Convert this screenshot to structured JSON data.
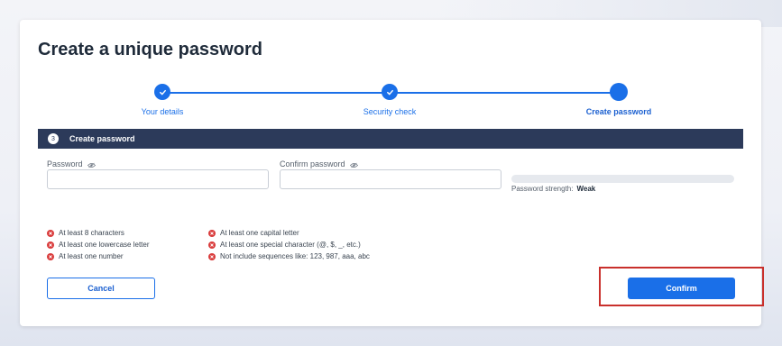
{
  "page": {
    "title": "Create a unique password"
  },
  "stepper": {
    "steps": [
      {
        "label": "Your details",
        "state": "done"
      },
      {
        "label": "Security check",
        "state": "done"
      },
      {
        "label": "Create password",
        "state": "current"
      }
    ]
  },
  "section": {
    "number": "3",
    "title": "Create password"
  },
  "fields": {
    "password": {
      "label": "Password",
      "value": "",
      "placeholder": ""
    },
    "confirm": {
      "label": "Confirm password",
      "value": "",
      "placeholder": ""
    }
  },
  "strength": {
    "label": "Password strength:",
    "value": "Weak",
    "level": 0
  },
  "rules": {
    "col1": [
      "At least 8 characters",
      "At least one lowercase letter",
      "At least one number"
    ],
    "col2": [
      "At least one capital letter",
      "At least one special character (@, $, _, etc.)",
      "Not include sequences like: 123, 987, aaa, abc"
    ]
  },
  "buttons": {
    "cancel": "Cancel",
    "confirm": "Confirm"
  },
  "colors": {
    "accent": "#1a6fe8",
    "header": "#2c3a5a",
    "error": "#d93b3b",
    "highlight": "#c9302c"
  }
}
